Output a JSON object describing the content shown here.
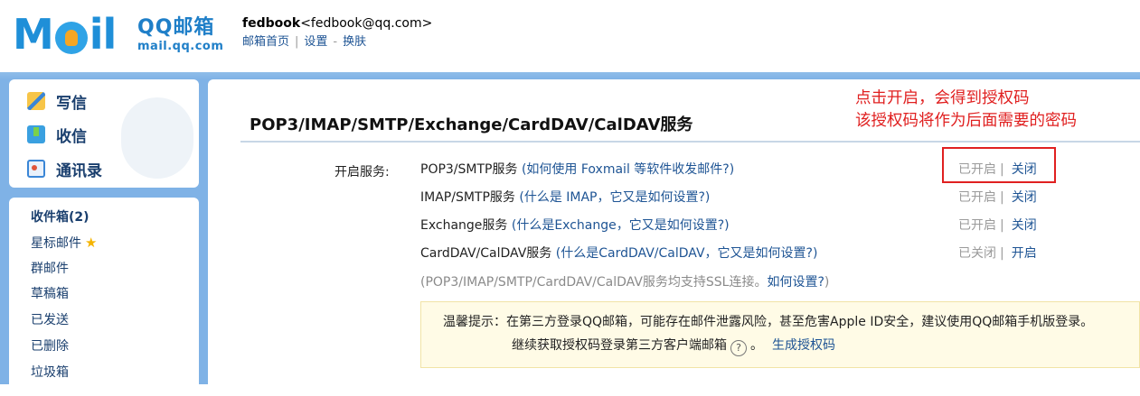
{
  "header": {
    "logo_text": "MOil",
    "logo_cn": "QQ邮箱",
    "logo_url": "mail.qq.com",
    "user_name": "fedbook",
    "user_email": "<fedbook@qq.com>",
    "links": [
      "邮箱首页",
      "设置",
      "换肤"
    ]
  },
  "nav": {
    "actions": [
      {
        "label": "写信",
        "icon": "pencil-note-icon"
      },
      {
        "label": "收信",
        "icon": "inbox-download-icon"
      },
      {
        "label": "通讯录",
        "icon": "contact-card-icon"
      }
    ],
    "folders": [
      "收件箱(2)",
      "星标邮件",
      "群邮件",
      "草稿箱",
      "已发送",
      "已删除",
      "垃圾箱"
    ]
  },
  "main": {
    "title": "POP3/IMAP/SMTP/Exchange/CardDAV/CalDAV服务",
    "service_label": "开启服务:",
    "services": [
      {
        "name": "POP3/SMTP服务",
        "help": "(如何使用 Foxmail 等软件收发邮件?)",
        "state": "已开启",
        "action": "关闭"
      },
      {
        "name": "IMAP/SMTP服务",
        "help": "(什么是 IMAP，它又是如何设置?)",
        "state": "已开启",
        "action": "关闭"
      },
      {
        "name": "Exchange服务",
        "help": "(什么是Exchange，它又是如何设置?)",
        "state": "已开启",
        "action": "关闭"
      },
      {
        "name": "CardDAV/CalDAV服务",
        "help": "(什么是CardDAV/CalDAV，它又是如何设置?)",
        "state": "已关闭",
        "action": "开启"
      }
    ],
    "ssl_note": "(POP3/IMAP/SMTP/CardDAV/CalDAV服务均支持SSL连接。",
    "ssl_help": "如何设置?",
    "ssl_close": ")",
    "annotation_line1": "点击开启，会得到授权码",
    "annotation_line2": "该授权码将作为后面需要的密码",
    "tip": {
      "line1": "温馨提示：在第三方登录QQ邮箱，可能存在邮件泄露风险，甚至危害Apple ID安全，建议使用QQ邮箱手机版登录。",
      "line2": "继续获取授权码登录第三方客户端邮箱",
      "help_symbol": "?",
      "punct": "。",
      "link": "生成授权码"
    }
  }
}
